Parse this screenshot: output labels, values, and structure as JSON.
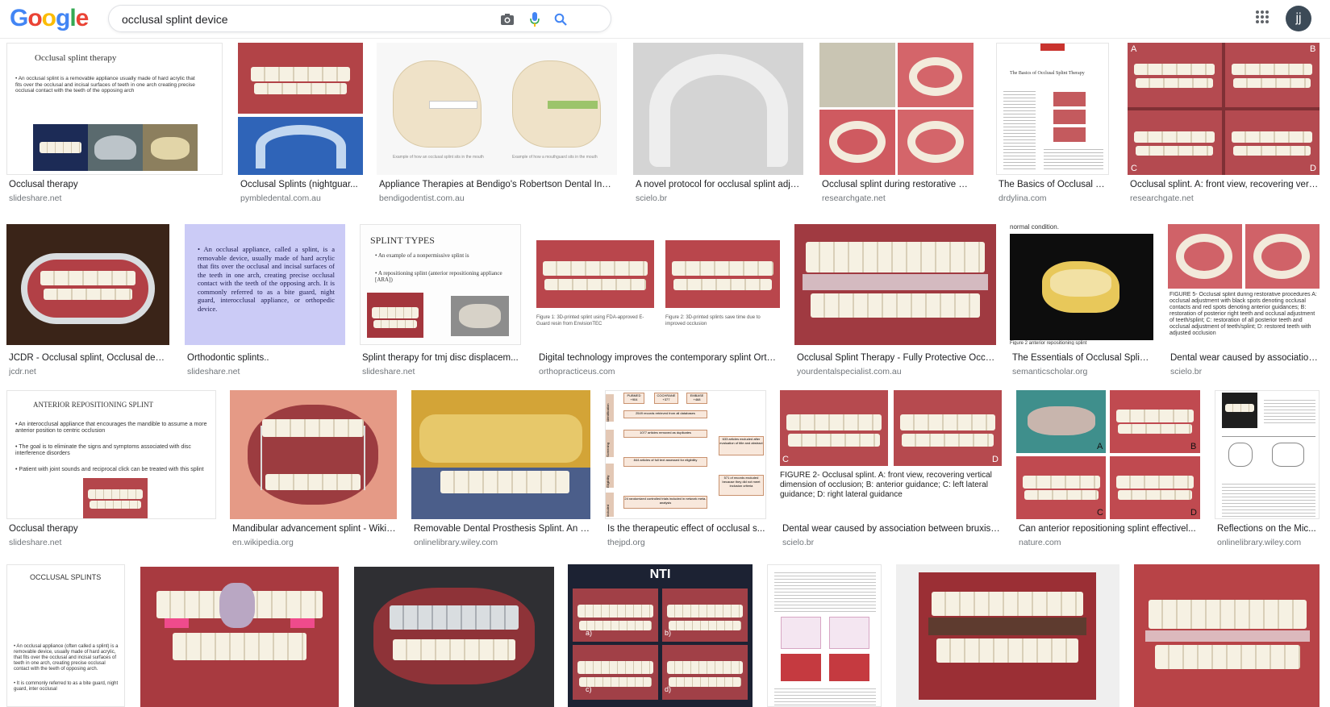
{
  "header": {
    "logo_letters": [
      "G",
      "o",
      "o",
      "g",
      "l",
      "e"
    ],
    "logo_colors": [
      "#4285F4",
      "#EA4335",
      "#FBBC05",
      "#4285F4",
      "#34A853",
      "#EA4335"
    ],
    "search_value": "occlusal splint device",
    "avatar_initials": "jj"
  },
  "rows": [
    [
      {
        "caption": "Occlusal therapy",
        "source": "slideshare.net",
        "slide_title": "Occlusal splint therapy",
        "slide_text": "• An occlusal splint is a removable appliance usually made of hard acrylic that fits over the occlusal and incisal surfaces of teeth in one arch creating precise occlusal contact with the teeth of the opposing arch"
      },
      {
        "caption": "Occlusal Splints (nightguar...",
        "source": "pymbledental.com.au"
      },
      {
        "caption": "Appliance Therapies at Bendigo's Robertson Dental Innov...",
        "source": "bendigodentist.com.au",
        "fig_caption_1": "Example of how an occlusal splint sits in the mouth",
        "fig_caption_2": "Example of how a mouthguard sits in the mouth"
      },
      {
        "caption": "A novel protocol for occlusal splint adju...",
        "source": "scielo.br"
      },
      {
        "caption": "Occlusal splint during restorative pro...",
        "source": "researchgate.net"
      },
      {
        "caption": "The Basics of Occlusal Sp...",
        "source": "drdylina.com",
        "doc_title": "The Basics of Occlusal Splint Therapy"
      },
      {
        "caption": "Occlusal splint. A: front view, recovering verti...",
        "source": "researchgate.net",
        "labels": [
          "A",
          "B",
          "C",
          "D"
        ]
      }
    ],
    [
      {
        "caption": "JCDR - Occlusal splint, Occlusal devic...",
        "source": "jcdr.net"
      },
      {
        "caption": "Orthodontic splints..",
        "source": "slideshare.net",
        "slide_text": "• An occlusal appliance, called a splint, is a removable device, usually made of hard acrylic that fits over the occlusal and incisal surfaces of the teeth in one arch, creating precise occlusal contact with the teeth of the opposing arch. It is commonly referred to as a bite guard, night guard, interocclusal appliance, or orthopedic device."
      },
      {
        "caption": "Splint therapy for tmj disc displacem...",
        "source": "slideshare.net",
        "slide_title": "SPLINT TYPES",
        "slide_text": "• An example of a nonpermissive splint is",
        "slide_text_2": "• A repositioning splint (anterior repositioning appliance [ARA])"
      },
      {
        "caption": "Digital technology improves the contemporary splint Orth...",
        "source": "orthopracticeus.com",
        "fig_caption_1": "Figure 1: 3D-printed splint using FDA-approved E-Guard resin from EnvisionTEC",
        "fig_caption_2": "Figure 2: 3D-printed splints save time due to improved occlusion"
      },
      {
        "caption": "Occlusal Splint Therapy - Fully Protective Occlu...",
        "source": "yourdentalspecialist.com.au"
      },
      {
        "caption": "The Essentials of Occlusal Splint...",
        "source": "semanticscholar.org",
        "top_text": "normal condition.",
        "bottom_text": "Figure 2 anterior repositioning splint"
      },
      {
        "caption": "Dental wear caused by association...",
        "source": "scielo.br",
        "fig_text": "FIGURE 5- Occlusal splint during restorative procedures A: occlusal adjustment with black spots denoting occlusal contacts and red spots denoting anterior guidances; B: restoration of posterior right teeth and occlusal adjustment of teeth/splint; C: restoration of all posterior teeth and occlusal adjustment of teeth/splint; D: restored teeth with adjusted occlusion"
      }
    ],
    [
      {
        "caption": "Occlusal therapy",
        "source": "slideshare.net",
        "slide_title": "ANTERIOR REPOSITIONING SPLINT",
        "slide_text_a": "• An interocclusal appliance that encourages the mandible to assume a more anterior position to centric occlusion",
        "slide_text_b": "• The goal is to eliminate the signs and symptoms associated with disc interference disorders",
        "slide_text_c": "• Patient with joint sounds and reciprocal click can be treated with this splint"
      },
      {
        "caption": "Mandibular advancement splint - Wikip...",
        "source": "en.wikipedia.org"
      },
      {
        "caption": "Removable Dental Prosthesis Splint. An O...",
        "source": "onlinelibrary.wiley.com"
      },
      {
        "caption": "Is the therapeutic effect of occlusal s...",
        "source": "thejpd.org",
        "boxes": [
          "PUBMED +904",
          "COCHRANE +377",
          "EMBASE +468",
          "2549 records retrieved from all databases",
          "1077 articles removed as duplicates",
          "844 articles of full text assessed for eligibility",
          "633 articles excluded after evaluation of title and abstract",
          "571 of records excluded because they did not meet inclusion criteria",
          "24 randomized controlled trials included in network meta-analysis"
        ],
        "side_labels": [
          "Identification",
          "Screening",
          "Eligibility",
          "Included"
        ]
      },
      {
        "caption": "Dental wear caused by association between bruxism...",
        "source": "scielo.br",
        "fig_text": "FIGURE 2- Occlusal splint. A: front view, recovering vertical dimension of occlusion; B: anterior guidance; C: left lateral guidance; D: right lateral guidance",
        "labels": [
          "C",
          "D"
        ]
      },
      {
        "caption": "Can anterior repositioning splint effectivel...",
        "source": "nature.com",
        "labels": [
          "A",
          "B",
          "C",
          "D"
        ]
      },
      {
        "caption": "Reflections on the Mic...",
        "source": "onlinelibrary.wiley.com"
      }
    ],
    [
      {
        "slide_title": "OCCLUSAL SPLINTS",
        "slide_text": "• An occlusal appliance (often called a splint) is a removable device, usually made of hard acrylic, that fits over the occlusal and incisal surfaces of teeth in one arch, creating precise occlusal contact with the teeth of opposing arch.",
        "slide_text_2": "• It is commonly referred to as a bite guard, night guard, inter occlusal"
      },
      {},
      {},
      {
        "title": "NTI",
        "labels": [
          "a)",
          "b)",
          "c)",
          "d)"
        ]
      },
      {},
      {},
      {}
    ]
  ]
}
